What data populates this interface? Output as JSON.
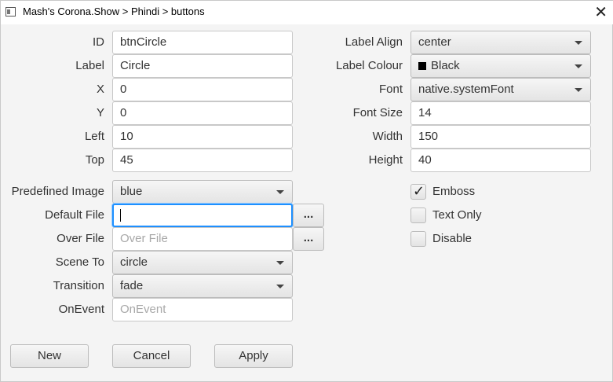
{
  "window": {
    "title": "Mash's Corona.Show > Phindi > buttons",
    "close": "✕"
  },
  "left": {
    "id": {
      "label": "ID",
      "value": "btnCircle"
    },
    "label": {
      "label": "Label",
      "value": "Circle"
    },
    "x": {
      "label": "X",
      "value": "0"
    },
    "y": {
      "label": "Y",
      "value": "0"
    },
    "left": {
      "label": "Left",
      "value": "10"
    },
    "top": {
      "label": "Top",
      "value": "45"
    }
  },
  "right": {
    "label_align": {
      "label": "Label Align",
      "value": "center"
    },
    "label_colour": {
      "label": "Label Colour",
      "value": "Black",
      "swatch": "#000000"
    },
    "font": {
      "label": "Font",
      "value": "native.systemFont"
    },
    "font_size": {
      "label": "Font Size",
      "value": "14"
    },
    "width": {
      "label": "Width",
      "value": "150"
    },
    "height": {
      "label": "Height",
      "value": "40"
    }
  },
  "image": {
    "predefined": {
      "label": "Predefined Image",
      "value": "blue"
    },
    "default_file": {
      "label": "Default File",
      "value": "",
      "browse": "..."
    },
    "over_file": {
      "label": "Over File",
      "placeholder": "Over File",
      "browse": "..."
    },
    "scene_to": {
      "label": "Scene To",
      "value": "circle"
    },
    "transition": {
      "label": "Transition",
      "value": "fade"
    },
    "on_event": {
      "label": "OnEvent",
      "placeholder": "OnEvent"
    }
  },
  "options": {
    "emboss": {
      "label": "Emboss",
      "checked": true,
      "mark": "✓"
    },
    "text_only": {
      "label": "Text Only",
      "checked": false
    },
    "disable": {
      "label": "Disable",
      "checked": false
    }
  },
  "buttons": {
    "new": "New",
    "cancel": "Cancel",
    "apply": "Apply"
  }
}
